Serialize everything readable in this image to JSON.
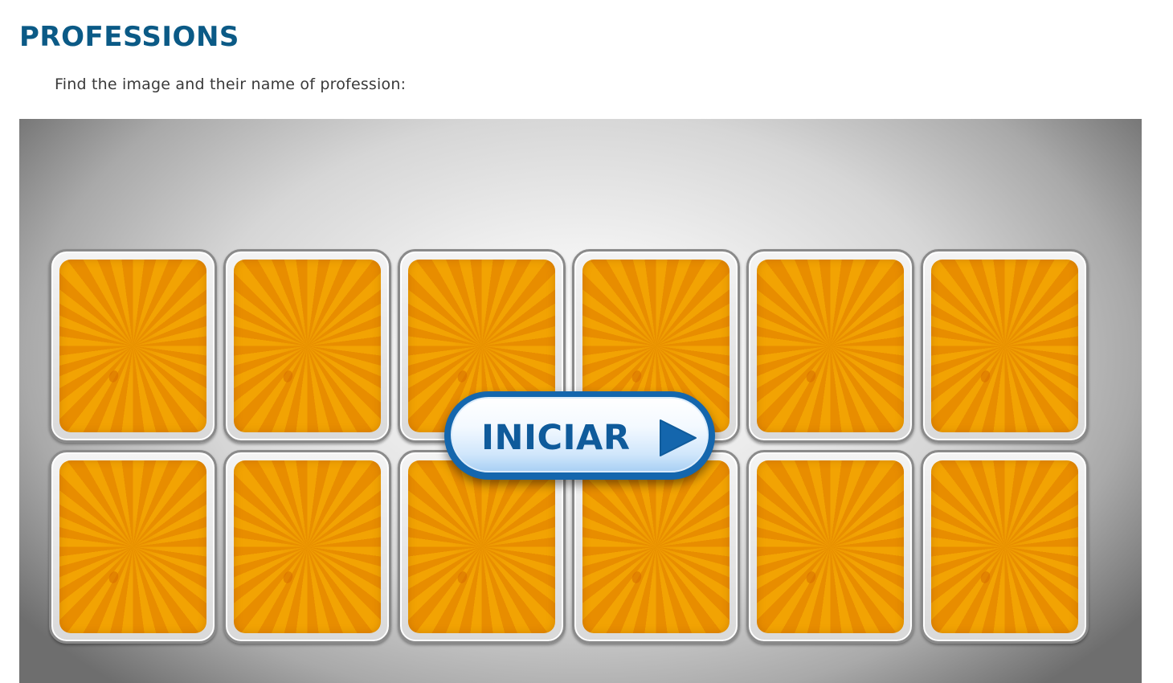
{
  "page": {
    "title": "PROFESSIONS",
    "instructions": "Find the image and their name of profession:"
  },
  "game": {
    "start_button_label": "INICIAR",
    "start_icon": "play-triangle-icon",
    "cards_rows": 2,
    "cards_per_row": 6,
    "card_back_pattern": "orange-sunburst",
    "colors": {
      "title": "#0b5a86",
      "card_back_primary": "#f2a303",
      "card_back_secondary": "#e88d00",
      "button_border": "#1466ad",
      "button_text": "#0f5b9b"
    }
  }
}
